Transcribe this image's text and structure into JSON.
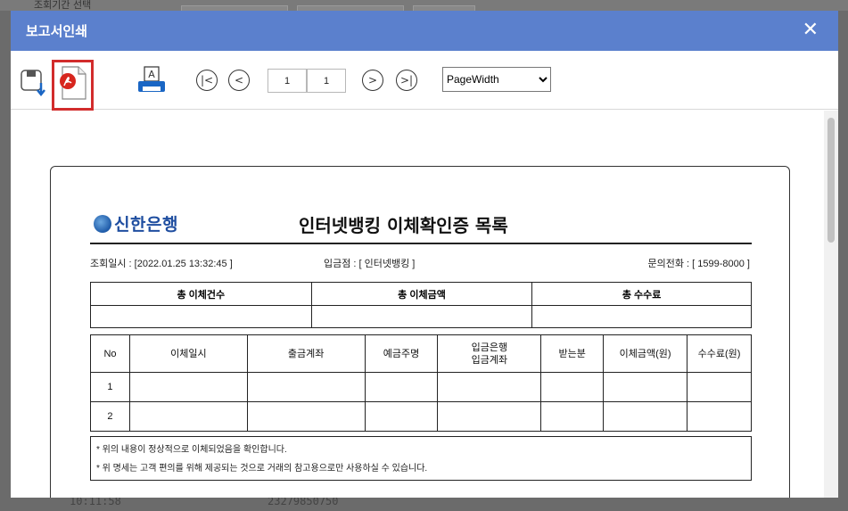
{
  "background": {
    "top_text": "조회기간 선택",
    "bottom_left": "10:11:58",
    "bottom_mid": "23279850750"
  },
  "modal": {
    "title": "보고서인쇄",
    "close_label": "✕"
  },
  "toolbar": {
    "first_page": "|<",
    "prev_page": "<",
    "current_page": "1",
    "total_pages": "1",
    "next_page": ">",
    "last_page": ">|",
    "zoom_selected": "PageWidth"
  },
  "report": {
    "bank_name": "신한은행",
    "title": "인터넷뱅킹 이체확인증 목록",
    "query_time": "조회일시 : [2022.01.25 13:32:45 ]",
    "deposit_branch": "입금점 : [ 인터넷뱅킹 ]",
    "phone": "문의전화 : [ 1599-8000 ]",
    "summary_headers": [
      "총 이체건수",
      "총 이체금액",
      "총 수수료"
    ],
    "summary_values": [
      "",
      "",
      ""
    ],
    "detail_headers": {
      "no": "No",
      "datetime": "이체일시",
      "from_account": "출금계좌",
      "owner": "예금주명",
      "to_bank_line1": "입금은행",
      "to_bank_line2": "입금계좌",
      "recipient": "받는분",
      "amount": "이체금액(원)",
      "fee": "수수료(원)"
    },
    "rows": [
      {
        "no": "1"
      },
      {
        "no": "2"
      }
    ],
    "notes": [
      "* 위의 내용이 정상적으로 이체되었음을 확인합니다.",
      "* 위 명세는 고객 편의를 위해 제공되는 것으로 거래의 참고용으로만 사용하실 수 있습니다."
    ]
  },
  "colors": {
    "title_bar": "#5b80cd",
    "pdf_highlight": "#d22c2c",
    "bank_blue": "#1f4ea0"
  }
}
